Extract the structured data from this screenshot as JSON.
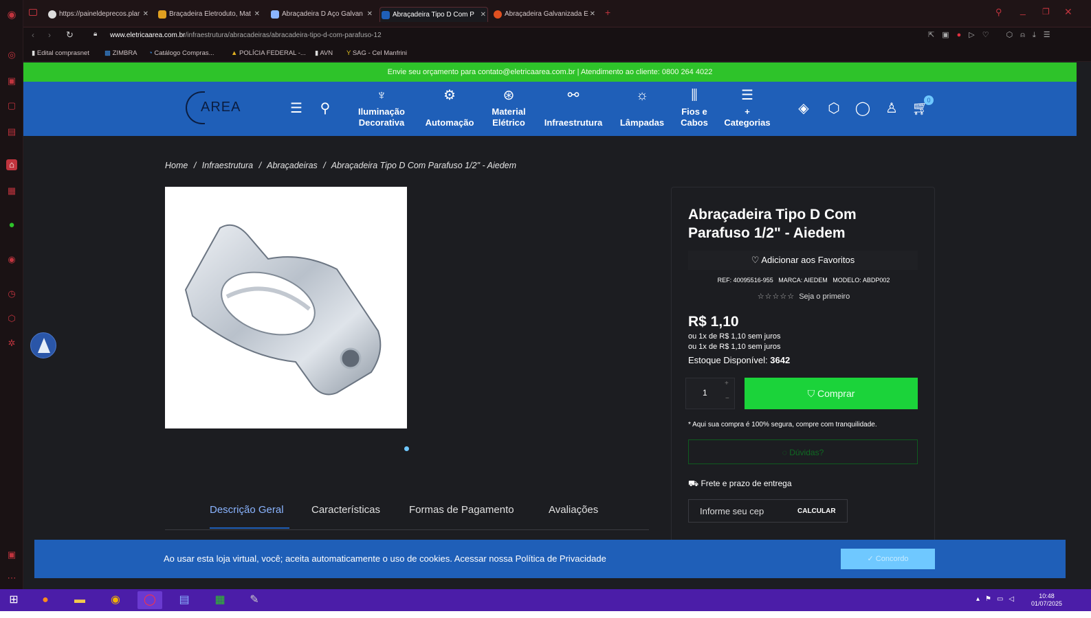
{
  "browser": {
    "tabs": [
      {
        "label": "https://paineldeprecos.plar"
      },
      {
        "label": "Braçadeira Eletroduto, Mat"
      },
      {
        "label": "Abraçadeira D Aço Galvan"
      },
      {
        "label": "Abraçadeira Tipo D Com P"
      },
      {
        "label": "Abraçadeira Galvanizada E"
      }
    ],
    "url_domain": "www.eletricaarea.com.br",
    "url_path": "/infraestrutura/abracadeiras/abracadeira-tipo-d-com-parafuso-12",
    "bookmarks": [
      "Edital comprasnet",
      "ZIMBRA",
      "Catálogo Compras...",
      "POLÍCIA FEDERAL -...",
      "AVN",
      "SAG - Cel Manfrini"
    ]
  },
  "site": {
    "promo": "Envie seu orçamento para contato@eletricaarea.com.br | Atendimento ao cliente: 0800 264 4022",
    "logo": "AREA",
    "nav": [
      {
        "label1": "Iluminação",
        "label2": "Decorativa"
      },
      {
        "label1": "Automação",
        "label2": ""
      },
      {
        "label1": "Material",
        "label2": "Elétrico"
      },
      {
        "label1": "Infraestrutura",
        "label2": ""
      },
      {
        "label1": "Lâmpadas",
        "label2": ""
      },
      {
        "label1": "Fios e",
        "label2": "Cabos"
      },
      {
        "label1": "+",
        "label2": "Categorias"
      }
    ],
    "cart_count": "0"
  },
  "breadcrumb": {
    "home": "Home",
    "c1": "Infraestrutura",
    "c2": "Abraçadeiras",
    "current": "Abraçadeira Tipo D Com Parafuso 1/2\" - Aiedem",
    "sep": "/"
  },
  "product": {
    "title": "Abraçadeira Tipo D Com Parafuso 1/2\" - Aiedem",
    "favorite": "Adicionar aos Favoritos",
    "ref_label": "REF:",
    "ref": "40095516-955",
    "brand_label": "MARCA:",
    "brand": "AIEDEM",
    "model_label": "MODELO:",
    "model": "ABDP002",
    "rating": 0,
    "rating_text": "Seja o primeiro",
    "price": "R$ 1,10",
    "installment1": "ou 1x de R$ 1,10 sem juros",
    "installment2": "ou 1x de R$ 1,10 sem juros",
    "stock_label": "Estoque Disponível:",
    "stock": "3642",
    "qty": "1",
    "buy": "Comprar",
    "secure": "* Aqui sua compra é 100% segura, compre com tranquilidade.",
    "doubts": "Dúvidas?",
    "shipping_title": "Frete e prazo de entrega",
    "cep_placeholder": "Informe seu cep",
    "calc": "CALCULAR"
  },
  "tabs": [
    "Descrição Geral",
    "Características",
    "Formas de Pagamento",
    "Avaliações"
  ],
  "cookie": {
    "text": "Ao usar esta loja virtual, você; aceita automaticamente o uso de cookies. Acessar nossa Política de Privacidade",
    "button": "Concordo"
  },
  "taskbar": {
    "time": "10:48",
    "date": "01/07/2025"
  },
  "colors": {
    "brand_blue": "#1f5fb8",
    "buy_green": "#1bd33a",
    "promo_green": "#2ec32a",
    "taskbar": "#4b1da8"
  }
}
